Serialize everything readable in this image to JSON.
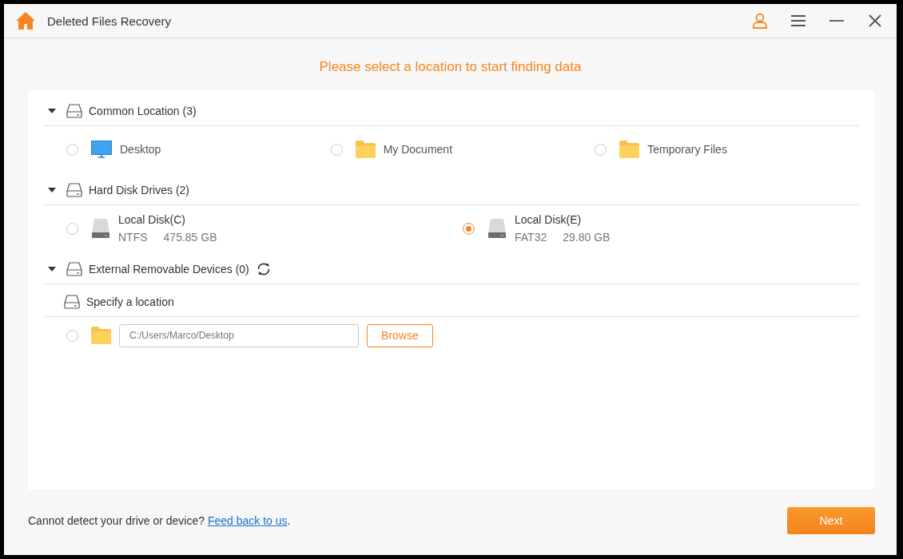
{
  "window": {
    "title": "Deleted Files Recovery"
  },
  "heading": "Please select a location to start finding data",
  "sections": [
    {
      "kind": "locations",
      "title": "Common Location (3)",
      "expanded": true,
      "items": [
        {
          "kind": "screen",
          "label": "Desktop",
          "selected": false
        },
        {
          "kind": "folder",
          "label": "My Document",
          "selected": false
        },
        {
          "kind": "folder",
          "label": "Temporary Files",
          "selected": false
        }
      ]
    },
    {
      "kind": "disks",
      "title": "Hard Disk Drives (2)",
      "expanded": true,
      "items": [
        {
          "kind": "disk",
          "label": "Local Disk(C)",
          "filesystem": "NTFS",
          "size": "475.85 GB",
          "selected": false
        },
        {
          "kind": "disk",
          "label": "Local Disk(E)",
          "filesystem": "FAT32",
          "size": "29.80 GB",
          "selected": true
        }
      ]
    },
    {
      "kind": "devices",
      "title": "External Removable Devices (0)",
      "expanded": true
    }
  ],
  "specify": {
    "title": "Specify a location",
    "path": "C:/Users/Marco/Desktop",
    "selected": false,
    "browse": "Browse"
  },
  "footer": {
    "text": "Cannot detect your drive or device? ",
    "link": "Feed back to us",
    "after": "."
  },
  "next": "Next"
}
